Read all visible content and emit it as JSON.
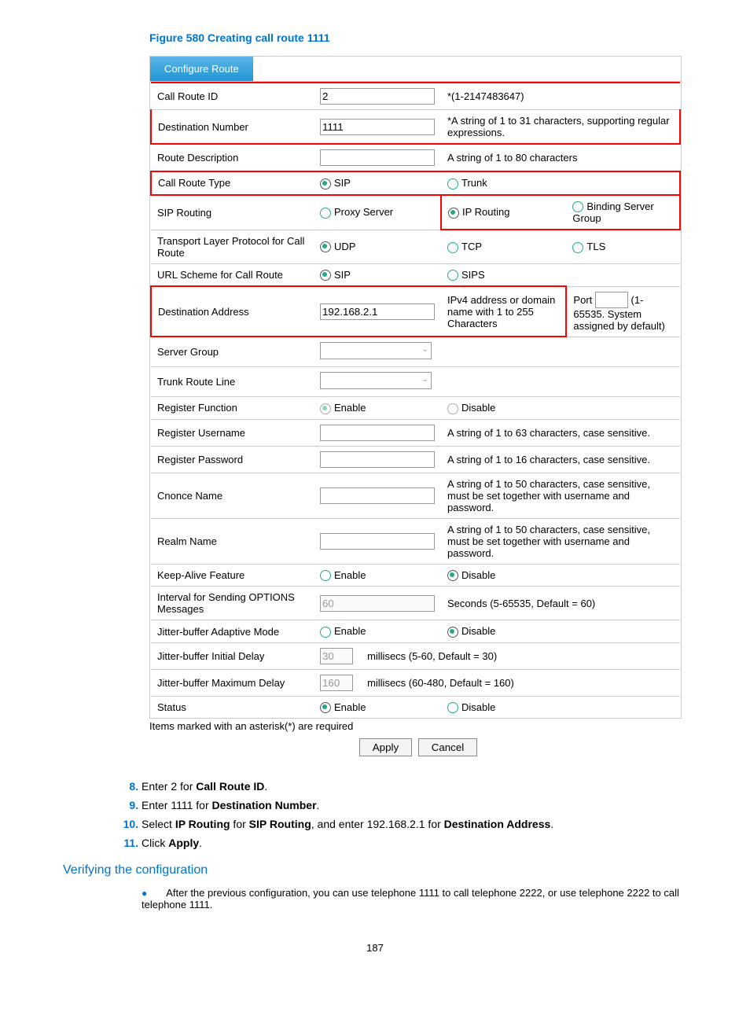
{
  "figure_title": "Figure 580 Creating call route 1111",
  "tab": "Configure Route",
  "rows": {
    "call_route_id": {
      "label": "Call Route ID",
      "value": "2",
      "hint": "*(1-2147483647)"
    },
    "dest_number": {
      "label": "Destination Number",
      "value": "1111",
      "hint": "*A string of 1 to 31 characters, supporting regular expressions."
    },
    "route_desc": {
      "label": "Route Description",
      "value": "",
      "hint": "A string of 1 to 80 characters"
    },
    "call_route_type": {
      "label": "Call Route Type",
      "opt1": "SIP",
      "opt2": "Trunk"
    },
    "sip_routing": {
      "label": "SIP Routing",
      "opt1": "Proxy Server",
      "opt2": "IP Routing",
      "opt3": "Binding Server Group"
    },
    "transport": {
      "label": "Transport Layer Protocol for Call Route",
      "opt1": "UDP",
      "opt2": "TCP",
      "opt3": "TLS"
    },
    "url_scheme": {
      "label": "URL Scheme for Call Route",
      "opt1": "SIP",
      "opt2": "SIPS"
    },
    "dest_addr": {
      "label": "Destination Address",
      "value": "192.168.2.1",
      "hint1": "IPv4 address or domain name with 1 to 255 Characters",
      "port_label": "Port",
      "port_value": "",
      "hint2": "(1-65535. System assigned by default)"
    },
    "server_group": {
      "label": "Server Group"
    },
    "trunk_line": {
      "label": "Trunk Route Line"
    },
    "register_fn": {
      "label": "Register Function",
      "opt1": "Enable",
      "opt2": "Disable"
    },
    "reg_user": {
      "label": "Register Username",
      "value": "",
      "hint": "A string of 1 to 63 characters, case sensitive."
    },
    "reg_pass": {
      "label": "Register Password",
      "value": "",
      "hint": "A string of 1 to 16 characters, case sensitive."
    },
    "cnonce": {
      "label": "Cnonce Name",
      "value": "",
      "hint": "A string of 1 to 50 characters, case sensitive, must be set together with username and password."
    },
    "realm": {
      "label": "Realm Name",
      "value": "",
      "hint": "A string of 1 to 50 characters, case sensitive, must be set together with username and password."
    },
    "keepalive": {
      "label": "Keep-Alive Feature",
      "opt1": "Enable",
      "opt2": "Disable"
    },
    "interval": {
      "label": "Interval for Sending OPTIONS Messages",
      "value": "60",
      "hint": "Seconds (5-65535, Default = 60)"
    },
    "jitter_mode": {
      "label": "Jitter-buffer Adaptive Mode",
      "opt1": "Enable",
      "opt2": "Disable"
    },
    "jitter_init": {
      "label": "Jitter-buffer Initial Delay",
      "value": "30",
      "hint": "millisecs (5-60, Default = 30)"
    },
    "jitter_max": {
      "label": "Jitter-buffer Maximum Delay",
      "value": "160",
      "hint": "millisecs (60-480, Default = 160)"
    },
    "status": {
      "label": "Status",
      "opt1": "Enable",
      "opt2": "Disable"
    }
  },
  "required_note": "Items marked with an asterisk(*) are required",
  "apply": "Apply",
  "cancel": "Cancel",
  "steps": {
    "s8": {
      "pre": "Enter 2 for ",
      "b": "Call Route ID",
      "post": "."
    },
    "s9": {
      "pre": "Enter 1111 for ",
      "b": "Destination Number",
      "post": "."
    },
    "s10": {
      "pre1": "Select ",
      "b1": "IP Routing",
      "mid1": " for ",
      "b2": "SIP Routing",
      "mid2": ", and enter 192.168.2.1 for ",
      "b3": "Destination Address",
      "post": "."
    },
    "s11": {
      "pre": "Click ",
      "b": "Apply",
      "post": "."
    }
  },
  "verify_head": "Verifying the configuration",
  "verify_text": "After the previous configuration, you can use telephone 1111 to call telephone 2222, or use telephone 2222 to call telephone 1111.",
  "page": "187"
}
